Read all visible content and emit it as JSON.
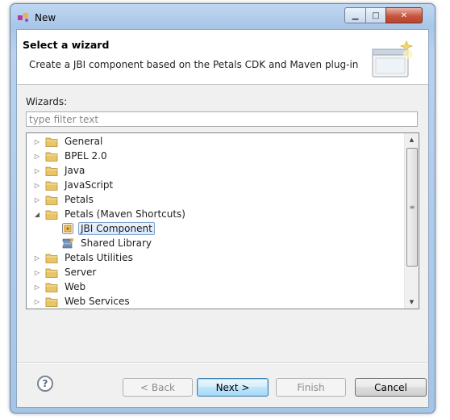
{
  "window": {
    "title": "New"
  },
  "header": {
    "title": "Select a wizard",
    "description": "Create a JBI component based on the Petals CDK and Maven plug-in"
  },
  "wizards_label": "Wizards:",
  "filter": {
    "placeholder": "type filter text",
    "value": ""
  },
  "tree": {
    "items": [
      {
        "label": "General",
        "type": "folder",
        "expanded": false,
        "level": 0
      },
      {
        "label": "BPEL 2.0",
        "type": "folder",
        "expanded": false,
        "level": 0
      },
      {
        "label": "Java",
        "type": "folder",
        "expanded": false,
        "level": 0
      },
      {
        "label": "JavaScript",
        "type": "folder",
        "expanded": false,
        "level": 0
      },
      {
        "label": "Petals",
        "type": "folder",
        "expanded": false,
        "level": 0
      },
      {
        "label": "Petals (Maven Shortcuts)",
        "type": "folder",
        "expanded": true,
        "level": 0
      },
      {
        "label": "JBI Component",
        "type": "jbi-component",
        "selected": true,
        "level": 1
      },
      {
        "label": "Shared Library",
        "type": "shared-library",
        "level": 1
      },
      {
        "label": "Petals Utilities",
        "type": "folder",
        "expanded": false,
        "level": 0
      },
      {
        "label": "Server",
        "type": "folder",
        "expanded": false,
        "level": 0
      },
      {
        "label": "Web",
        "type": "folder",
        "expanded": false,
        "level": 0
      },
      {
        "label": "Web Services",
        "type": "folder",
        "expanded": false,
        "level": 0
      }
    ]
  },
  "buttons": {
    "back": "< Back",
    "next": "Next >",
    "finish": "Finish",
    "cancel": "Cancel",
    "help": "?"
  },
  "icons": {
    "window_minimize": "minimize-icon",
    "window_maximize": "maximize-icon",
    "window_close": "close-icon",
    "help": "help-icon",
    "folder": "folder-icon"
  },
  "colors": {
    "selection_border": "#7da2ce",
    "folder_fill": "#e9c56a",
    "default_button_border": "#3c7fb1"
  }
}
